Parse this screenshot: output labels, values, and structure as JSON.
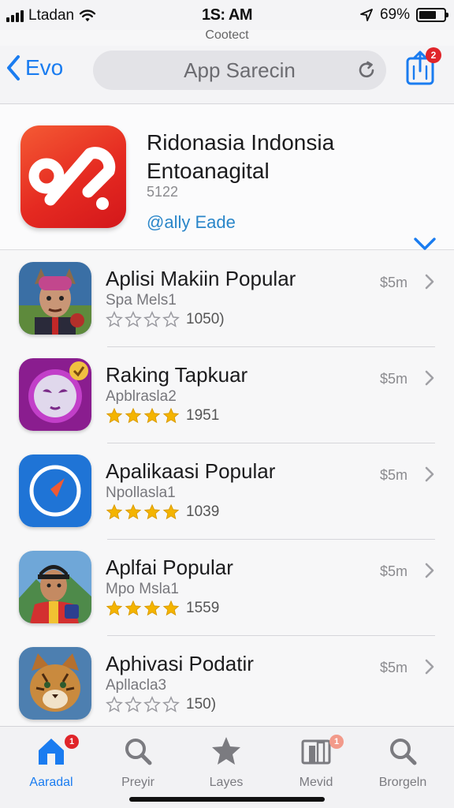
{
  "status_bar": {
    "carrier": "Ltadan",
    "time": "1S: AM",
    "battery_percent": "69%",
    "battery_level": 0.69,
    "subtitle": "Cootect"
  },
  "nav": {
    "back_label": "Evo",
    "search_text": "App Sarecin",
    "share_badge": "2"
  },
  "featured": {
    "name": "Ridonasia Indonsia Entoanagital",
    "id": "5122",
    "link": "@ally Eade"
  },
  "apps": [
    {
      "title": "Aplisi Makiin Popular",
      "subtitle": "Spa Mels1",
      "rating": 0,
      "count": "1050)",
      "price": "$5m"
    },
    {
      "title": "Raking Tapkuar",
      "subtitle": "Apblrasla2",
      "rating": 4,
      "count": "1951",
      "price": "$5m"
    },
    {
      "title": "Apalikaasi Popular",
      "subtitle": "Npollasla1",
      "rating": 4,
      "count": "1039",
      "price": "$5m"
    },
    {
      "title": "Aplfai Popular",
      "subtitle": "Mpo Msla1",
      "rating": 4,
      "count": "1559",
      "price": "$5m"
    },
    {
      "title": "Aphivasi Podatir",
      "subtitle": "Apllaclа3",
      "rating": 0,
      "count": "150)",
      "price": "$5m"
    }
  ],
  "tabs": [
    {
      "label": "Aaradal",
      "icon": "home-icon",
      "badge": "1",
      "active": true
    },
    {
      "label": "Preyir",
      "icon": "search-icon",
      "badge": "",
      "active": false
    },
    {
      "label": "Layes",
      "icon": "star-icon",
      "badge": "",
      "active": false
    },
    {
      "label": "Mevid",
      "icon": "library-icon",
      "badge": "1",
      "active": false
    },
    {
      "label": "Brorgeln",
      "icon": "search-icon",
      "badge": "",
      "active": false
    }
  ],
  "colors": {
    "accent": "#1a7cf0",
    "badge": "#e0252a",
    "star": "#f4b400",
    "featured_icon": "#e52a21"
  }
}
